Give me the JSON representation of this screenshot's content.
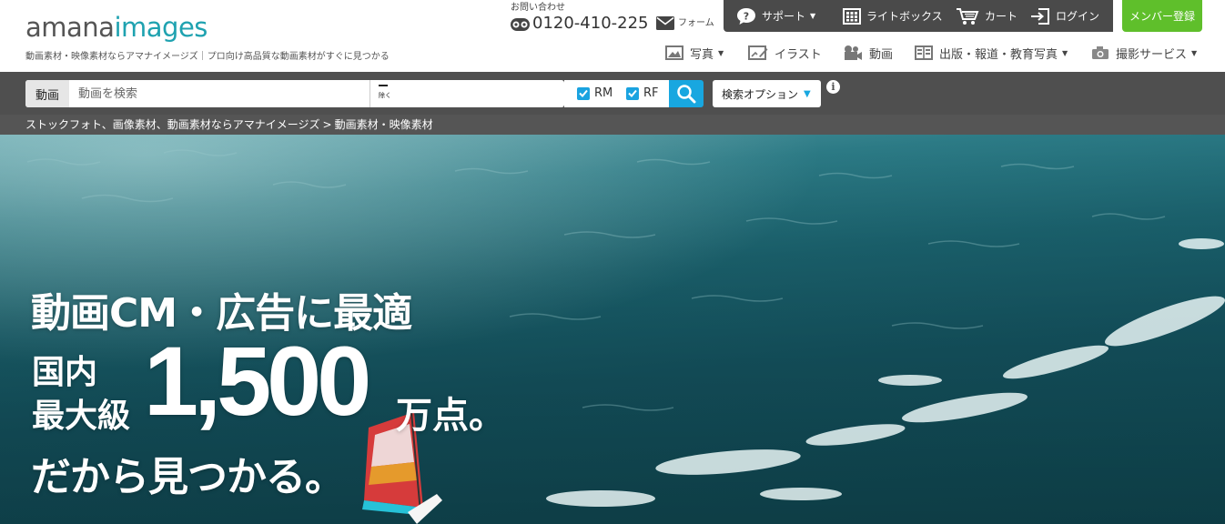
{
  "header": {
    "logo_part1": "amana",
    "logo_part2": "images",
    "tagline": "動画素材・映像素材ならアマナイメージズ｜プロ向け高品質な動画素材がすぐに見つかる",
    "contact_label": "お問い合わせ",
    "phone": "0120-410-225",
    "form_link": "フォーム"
  },
  "topbar": {
    "support": "サポート",
    "lightbox": "ライトボックス",
    "cart": "カート",
    "login": "ログイン",
    "signup": "メンバー登録"
  },
  "catnav": [
    {
      "label": "写真",
      "has_caret": true,
      "icon": "photo-icon"
    },
    {
      "label": "イラスト",
      "has_caret": false,
      "icon": "illustration-icon"
    },
    {
      "label": "動画",
      "has_caret": false,
      "icon": "video-camera-icon"
    },
    {
      "label": "出版・報道・教育写真",
      "has_caret": true,
      "icon": "book-icon"
    },
    {
      "label": "撮影サービス",
      "has_caret": true,
      "icon": "camera-icon"
    }
  ],
  "search": {
    "type": "動画",
    "placeholder": "動画を検索",
    "exclude_label": "除く",
    "rm": "RM",
    "rf": "RF",
    "rm_checked": true,
    "rf_checked": true,
    "options": "検索オプション",
    "info": "i"
  },
  "breadcrumb": {
    "home": "ストックフォト、画像素材、動画素材ならアマナイメージズ",
    "separator": ">",
    "current": "動画素材・映像素材"
  },
  "hero": {
    "line1": "動画CM・広告に最適",
    "kokunai": "国内",
    "saidai": "最大級",
    "number": "1,500",
    "unit": "万点。",
    "line3": "だから見つかる。"
  },
  "colors": {
    "accent": "#1fa2b0",
    "topbar": "#4a4a4a",
    "signup": "#5fbf2b",
    "search_button": "#18a7e0",
    "searchbar": "#4f4f4f"
  }
}
